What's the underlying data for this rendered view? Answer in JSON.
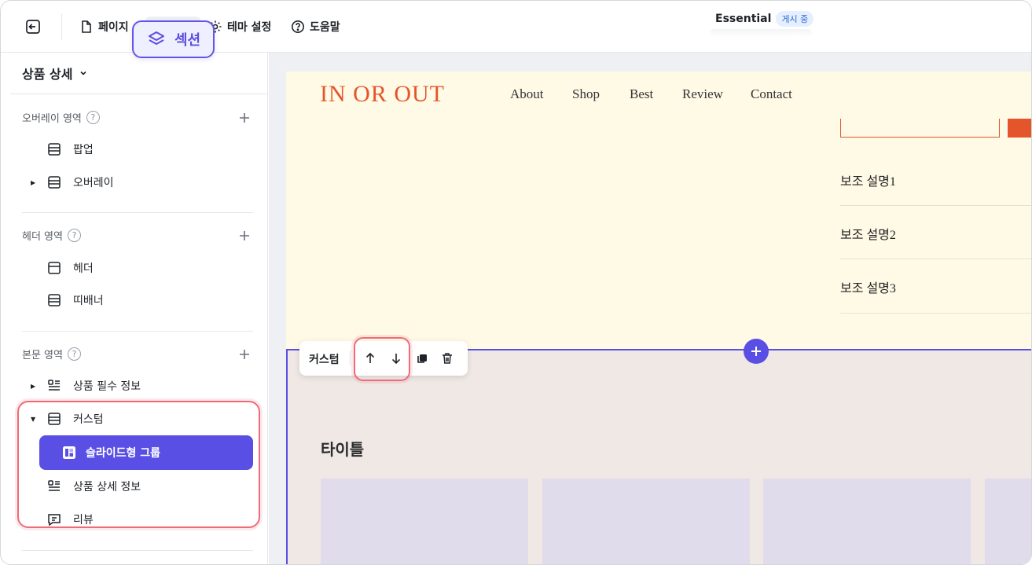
{
  "topbar": {
    "pages_label": "페이지",
    "section_label": "섹션",
    "theme_label": "테마 설정",
    "help_label": "도움말",
    "theme_name": "Essential",
    "theme_status": "게시 중"
  },
  "sidebar": {
    "page_selector": "상품 상세",
    "groups": [
      {
        "title": "오버레이 영역",
        "items": [
          {
            "label": "팝업"
          },
          {
            "label": "오버레이"
          }
        ]
      },
      {
        "title": "헤더 영역",
        "items": [
          {
            "label": "헤더"
          },
          {
            "label": "띠배너"
          }
        ]
      },
      {
        "title": "본문 영역",
        "items": [
          {
            "label": "상품 필수 정보"
          },
          {
            "label": "커스텀"
          },
          {
            "label": "슬라이드형 그룹"
          },
          {
            "label": "상품 상세 정보"
          },
          {
            "label": "리뷰"
          }
        ]
      }
    ],
    "help_mark": "?"
  },
  "preview": {
    "logo": "IN OR OUT",
    "nav": [
      "About",
      "Shop",
      "Best",
      "Review",
      "Contact"
    ],
    "descriptions": [
      "보조 설명1",
      "보조 설명2",
      "보조 설명3"
    ],
    "section_title": "타이틀"
  },
  "section_toolbar": {
    "label": "커스텀"
  },
  "colors": {
    "accent": "#5a4fe5",
    "brand": "#e4552b",
    "highlight": "#ee6b77"
  }
}
